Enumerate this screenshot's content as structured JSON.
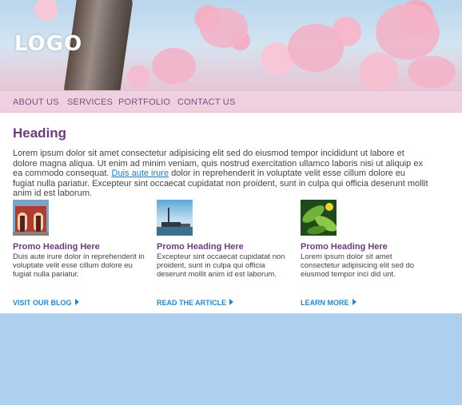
{
  "banner": {
    "logo_text": "LOGO"
  },
  "nav": [
    {
      "label": "ABOUT US"
    },
    {
      "label": "SERVICES"
    },
    {
      "label": "PORTFOLIO"
    },
    {
      "label": "CONTACT US"
    }
  ],
  "main": {
    "heading": "Heading",
    "intro_before": "Lorem ipsum dolor sit amet consectetur adipisicing elit sed do eiusmod tempor incididunt ut labore et dolore magna aliqua. Ut enim ad minim veniam, quis nostrud exercitation ullamco laboris nisi ut aliquip ex ea commodo consequat. ",
    "intro_link": "Duis aute irure",
    "intro_after": " dolor in reprehenderit in voluptate velit esse cillum dolore eu fugiat nulla pariatur. Excepteur sint occaecat cupidatat non proident, sunt in culpa qui officia deserunt mollit anim id est laborum."
  },
  "promos": [
    {
      "heading": "Promo Heading Here",
      "text": "Duis aute irure dolor in reprehenderit in voluptate velit esse cillum dolore eu fugiat nulla pariatur.",
      "link": "VISIT OUR BLOG"
    },
    {
      "heading": "Promo Heading Here",
      "text": "Excepteur sint occaecat cupidatat non proident, sunt in culpa qui officia deserunt mollit anim id est laborum.",
      "link": "READ THE ARTICLE"
    },
    {
      "heading": "Promo Heading Here",
      "text": "Lorem ipsum dolor sit amet consectetur adipisicing elit sed do eiusmod tempor inci did unt.",
      "link": "LEARN MORE"
    }
  ],
  "colors": {
    "page_background": "#aed0f0",
    "nav_background": "#efd0e0",
    "heading": "#6c3c7a",
    "link": "#2a86c2"
  }
}
